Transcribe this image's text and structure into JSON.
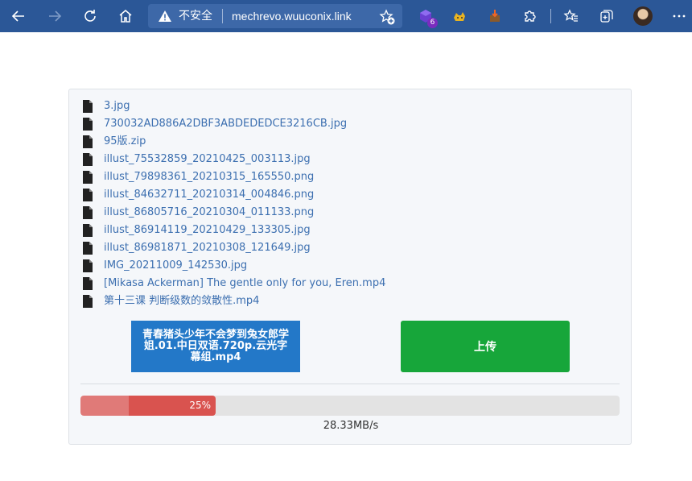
{
  "browser": {
    "security_label": "不安全",
    "url": "mechrevo.wuuconix.link",
    "extension_badge_count": "6",
    "icons": [
      "back-arrow-icon",
      "forward-arrow-icon",
      "refresh-icon",
      "home-icon",
      "warning-icon",
      "add-favorite-icon",
      "extension-cube-icon",
      "extension-cat-icon",
      "extension-box-icon",
      "puzzle-icon",
      "favorites-icon",
      "collections-icon",
      "profile-avatar",
      "more-icon"
    ],
    "colors": {
      "toolbar": "#2b5797",
      "addressbar": "#3d68a8"
    }
  },
  "files": [
    "3.jpg",
    "730032AD886A2DBF3ABDEDEDCE3216CB.jpg",
    "95版.zip",
    "illust_75532859_20210425_003113.jpg",
    "illust_79898361_20210315_165550.png",
    "illust_84632711_20210314_004846.png",
    "illust_86805716_20210304_011133.png",
    "illust_86914119_20210429_133305.jpg",
    "illust_86981871_20210308_121649.jpg",
    "IMG_20211009_142530.jpg",
    "[Mikasa Ackerman] The gentle only for you, Eren.mp4",
    "第十三课 判断级数的敛散性.mp4"
  ],
  "actions": {
    "selected_file_label": "青春猪头少年不会梦到兔女郎学姐.01.中日双语.720p.云光字幕组.mp4",
    "upload_label": "上传"
  },
  "progress": {
    "percent": 25,
    "label": "25%",
    "speed": "28.33MB/s"
  },
  "theme": {
    "link": "#3c6fb0",
    "file_button": "#2378c8",
    "upload_button": "#17a63a",
    "progress": "#d9534f"
  }
}
